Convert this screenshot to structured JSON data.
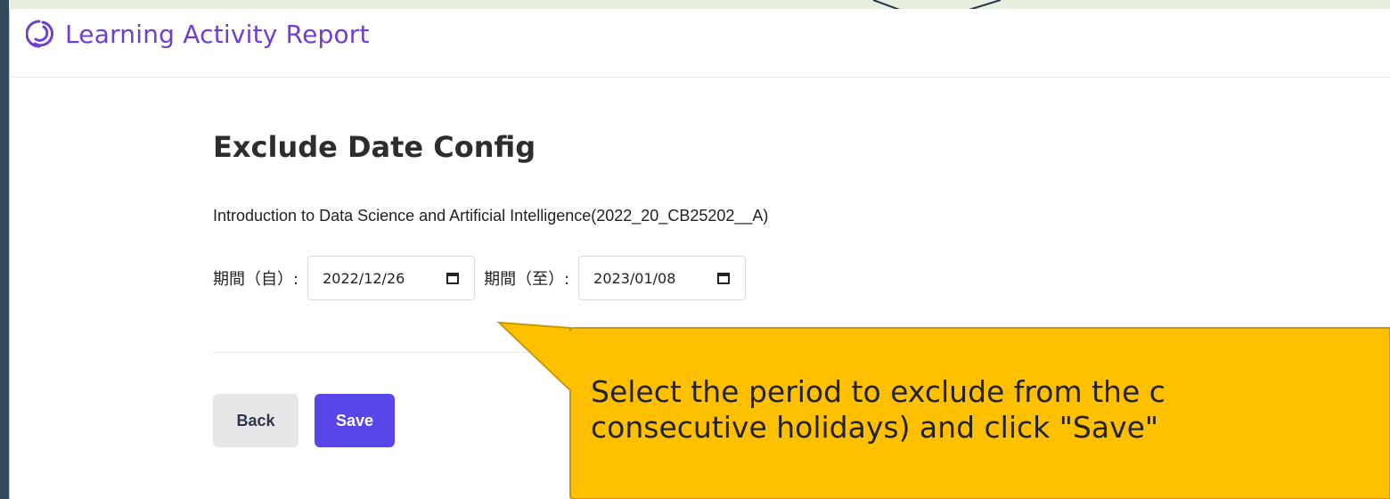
{
  "app": {
    "title": "Learning Activity Report"
  },
  "page": {
    "title": "Exclude Date Config",
    "course_name": "Introduction to Data Science and Artificial Intelligence(2022_20_CB25202__A)"
  },
  "dates": {
    "from_label": "期間（自）:",
    "from_value": "2022/12/26",
    "to_label": "期間（至）:",
    "to_value": "2023/01/08"
  },
  "actions": {
    "back_label": "Back",
    "save_label": "Save"
  },
  "callout": {
    "text": "Select the period to exclude from the c\nconsecutive holidays) and click \"Save\""
  },
  "icons": {
    "brand": "activity-ring-icon",
    "calendar": "calendar-icon"
  },
  "colors": {
    "brand": "#6f3fd1",
    "save_button": "#5846e8",
    "callout_fill": "#ffc000",
    "callout_border": "#c69a00"
  }
}
